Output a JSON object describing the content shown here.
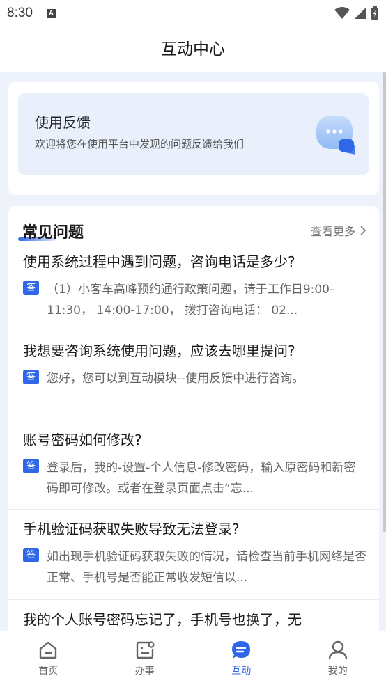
{
  "status_bar": {
    "time": "8:30",
    "notification_letter": "A"
  },
  "header": {
    "title": "互动中心"
  },
  "feedback": {
    "title": "使用反馈",
    "description": "欢迎将您在使用平台中发现的问题反馈给我们",
    "icon": "chat-bubble-icon"
  },
  "faq": {
    "title": "常见问题",
    "more_label": "查看更多",
    "answer_badge": "答",
    "items": [
      {
        "question": "使用系统过程中遇到问题，咨询电话是多少?",
        "answer": "（1）小客车高峰预约通行政策问题，请于工作日9:00-11:30， 14:00-17:00， 拨打咨询电话： 02..."
      },
      {
        "question": "我想要咨询系统使用问题，应该去哪里提问?",
        "answer": "您好，您可以到互动模块--使用反馈中进行咨询。"
      },
      {
        "question": "账号密码如何修改?",
        "answer": "登录后，我的-设置-个人信息-修改密码，输入原密码和新密码即可修改。或者在登录页面点击“忘..."
      },
      {
        "question": "手机验证码获取失败导致无法登录?",
        "answer": "如出现手机验证码获取失败的情况，请检查当前手机网络是否正常、手机号是否能正常收发短信以..."
      },
      {
        "question": "我的个人账号密码忘记了，手机号也换了，无",
        "answer": ""
      }
    ]
  },
  "tabs": [
    {
      "label": "首页",
      "icon": "home-icon",
      "active": false
    },
    {
      "label": "办事",
      "icon": "tasks-icon",
      "active": false
    },
    {
      "label": "互动",
      "icon": "chat-icon",
      "active": true
    },
    {
      "label": "我的",
      "icon": "user-icon",
      "active": false
    }
  ],
  "colors": {
    "accent": "#2f67e8",
    "background": "#eef3fb"
  }
}
